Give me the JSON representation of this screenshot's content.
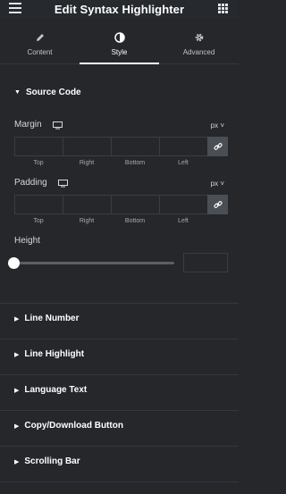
{
  "header": {
    "title": "Edit Syntax Highlighter"
  },
  "tabs": [
    {
      "label": "Content",
      "icon": "pencil-icon"
    },
    {
      "label": "Style",
      "icon": "contrast-icon"
    },
    {
      "label": "Advanced",
      "icon": "gear-icon"
    }
  ],
  "source_code": {
    "title": "Source Code",
    "margin": {
      "label": "Margin",
      "unit": "px",
      "top": "",
      "right": "",
      "bottom": "",
      "left": ""
    },
    "padding": {
      "label": "Padding",
      "unit": "px",
      "top": "",
      "right": "",
      "bottom": "",
      "left": ""
    },
    "dim_labels": [
      "Top",
      "Right",
      "Bottom",
      "Left"
    ],
    "height": {
      "label": "Height",
      "value": ""
    }
  },
  "sections": [
    "Line Number",
    "Line Highlight",
    "Language Text",
    "Copy/Download Button",
    "Scrolling Bar"
  ],
  "colors": {
    "background": "#25272b",
    "accent": "#ffffff",
    "link_button": "#4a4e55"
  }
}
